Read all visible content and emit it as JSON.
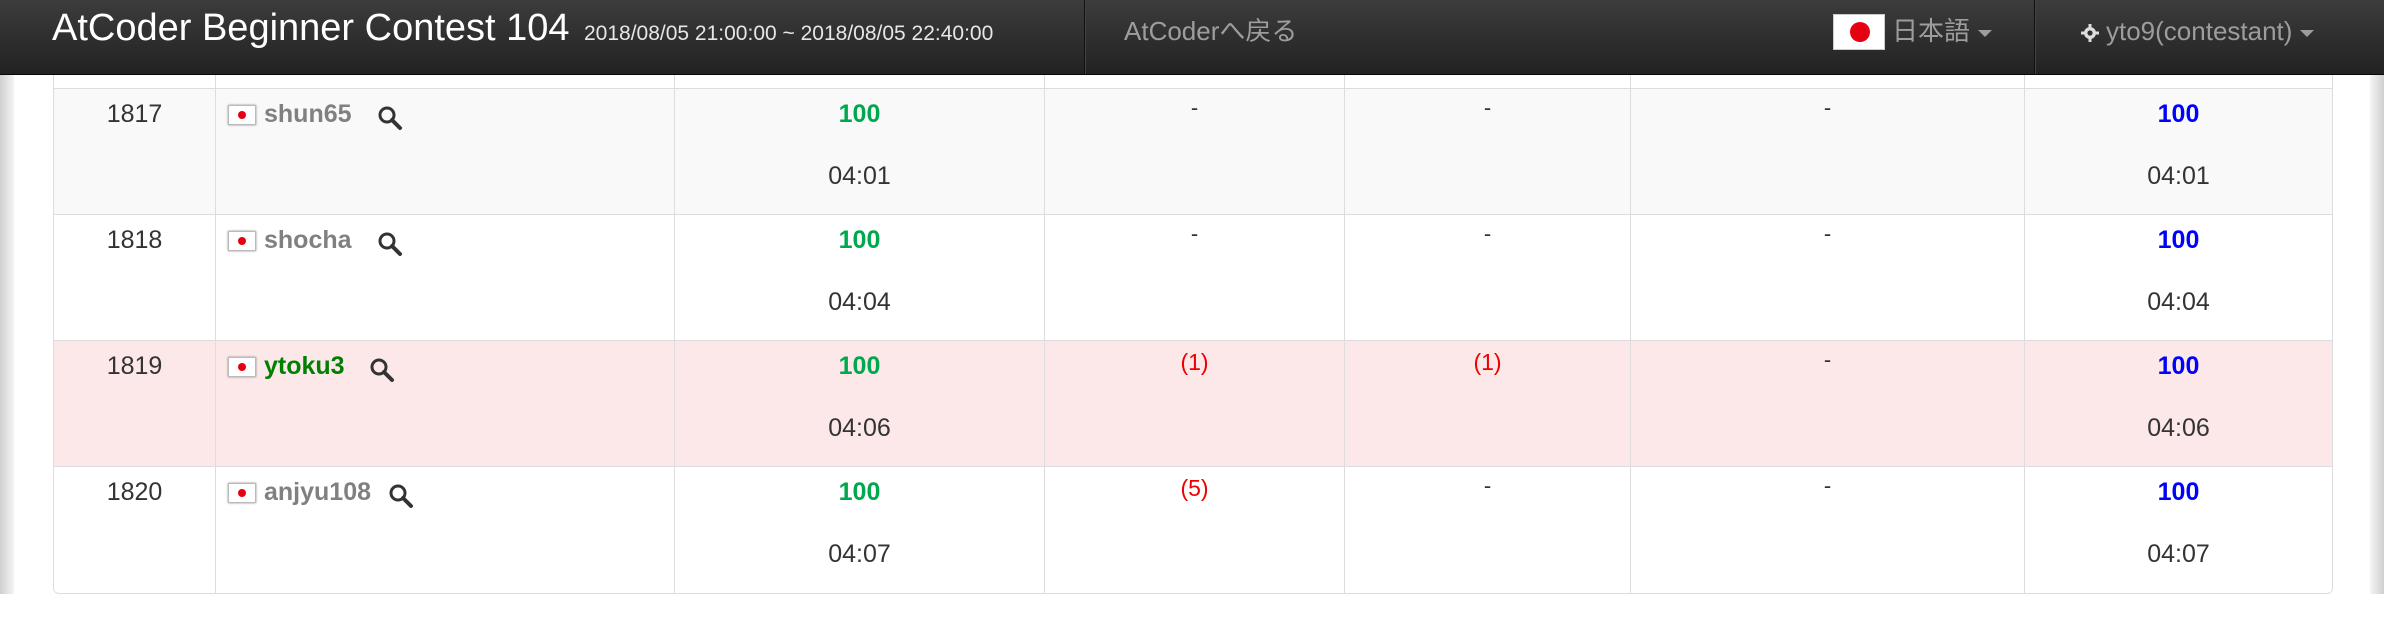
{
  "navbar": {
    "contest_title": "AtCoder Beginner Contest 104",
    "contest_time": "2018/08/05 21:00:00 ~ 2018/08/05 22:40:00",
    "back_link": "AtCoderへ戻る",
    "language": "日本語",
    "user_menu": "yto9(contestant)"
  },
  "colors": {
    "accepted": "#00a84d",
    "total": "#0000ff",
    "wrong": "#ee0000",
    "user_gray": "#808080",
    "user_green": "#008000",
    "highlight_row": "#fce8e8"
  },
  "standings": [
    {
      "rank": "1817",
      "user": "shun65",
      "user_color": "gray",
      "a_score": "100",
      "a_time": "04:01",
      "b": "-",
      "c": "-",
      "d": "-",
      "total": "100",
      "total_time": "04:01"
    },
    {
      "rank": "1818",
      "user": "shocha",
      "user_color": "gray",
      "a_score": "100",
      "a_time": "04:04",
      "b": "-",
      "c": "-",
      "d": "-",
      "total": "100",
      "total_time": "04:04"
    },
    {
      "rank": "1819",
      "user": "ytoku3",
      "user_color": "green",
      "a_score": "100",
      "a_time": "04:06",
      "b": "(1)",
      "c": "(1)",
      "d": "-",
      "total": "100",
      "total_time": "04:06"
    },
    {
      "rank": "1820",
      "user": "anjyu108",
      "user_color": "gray",
      "a_score": "100",
      "a_time": "04:07",
      "b": "(5)",
      "c": "-",
      "d": "-",
      "total": "100",
      "total_time": "04:07"
    }
  ]
}
